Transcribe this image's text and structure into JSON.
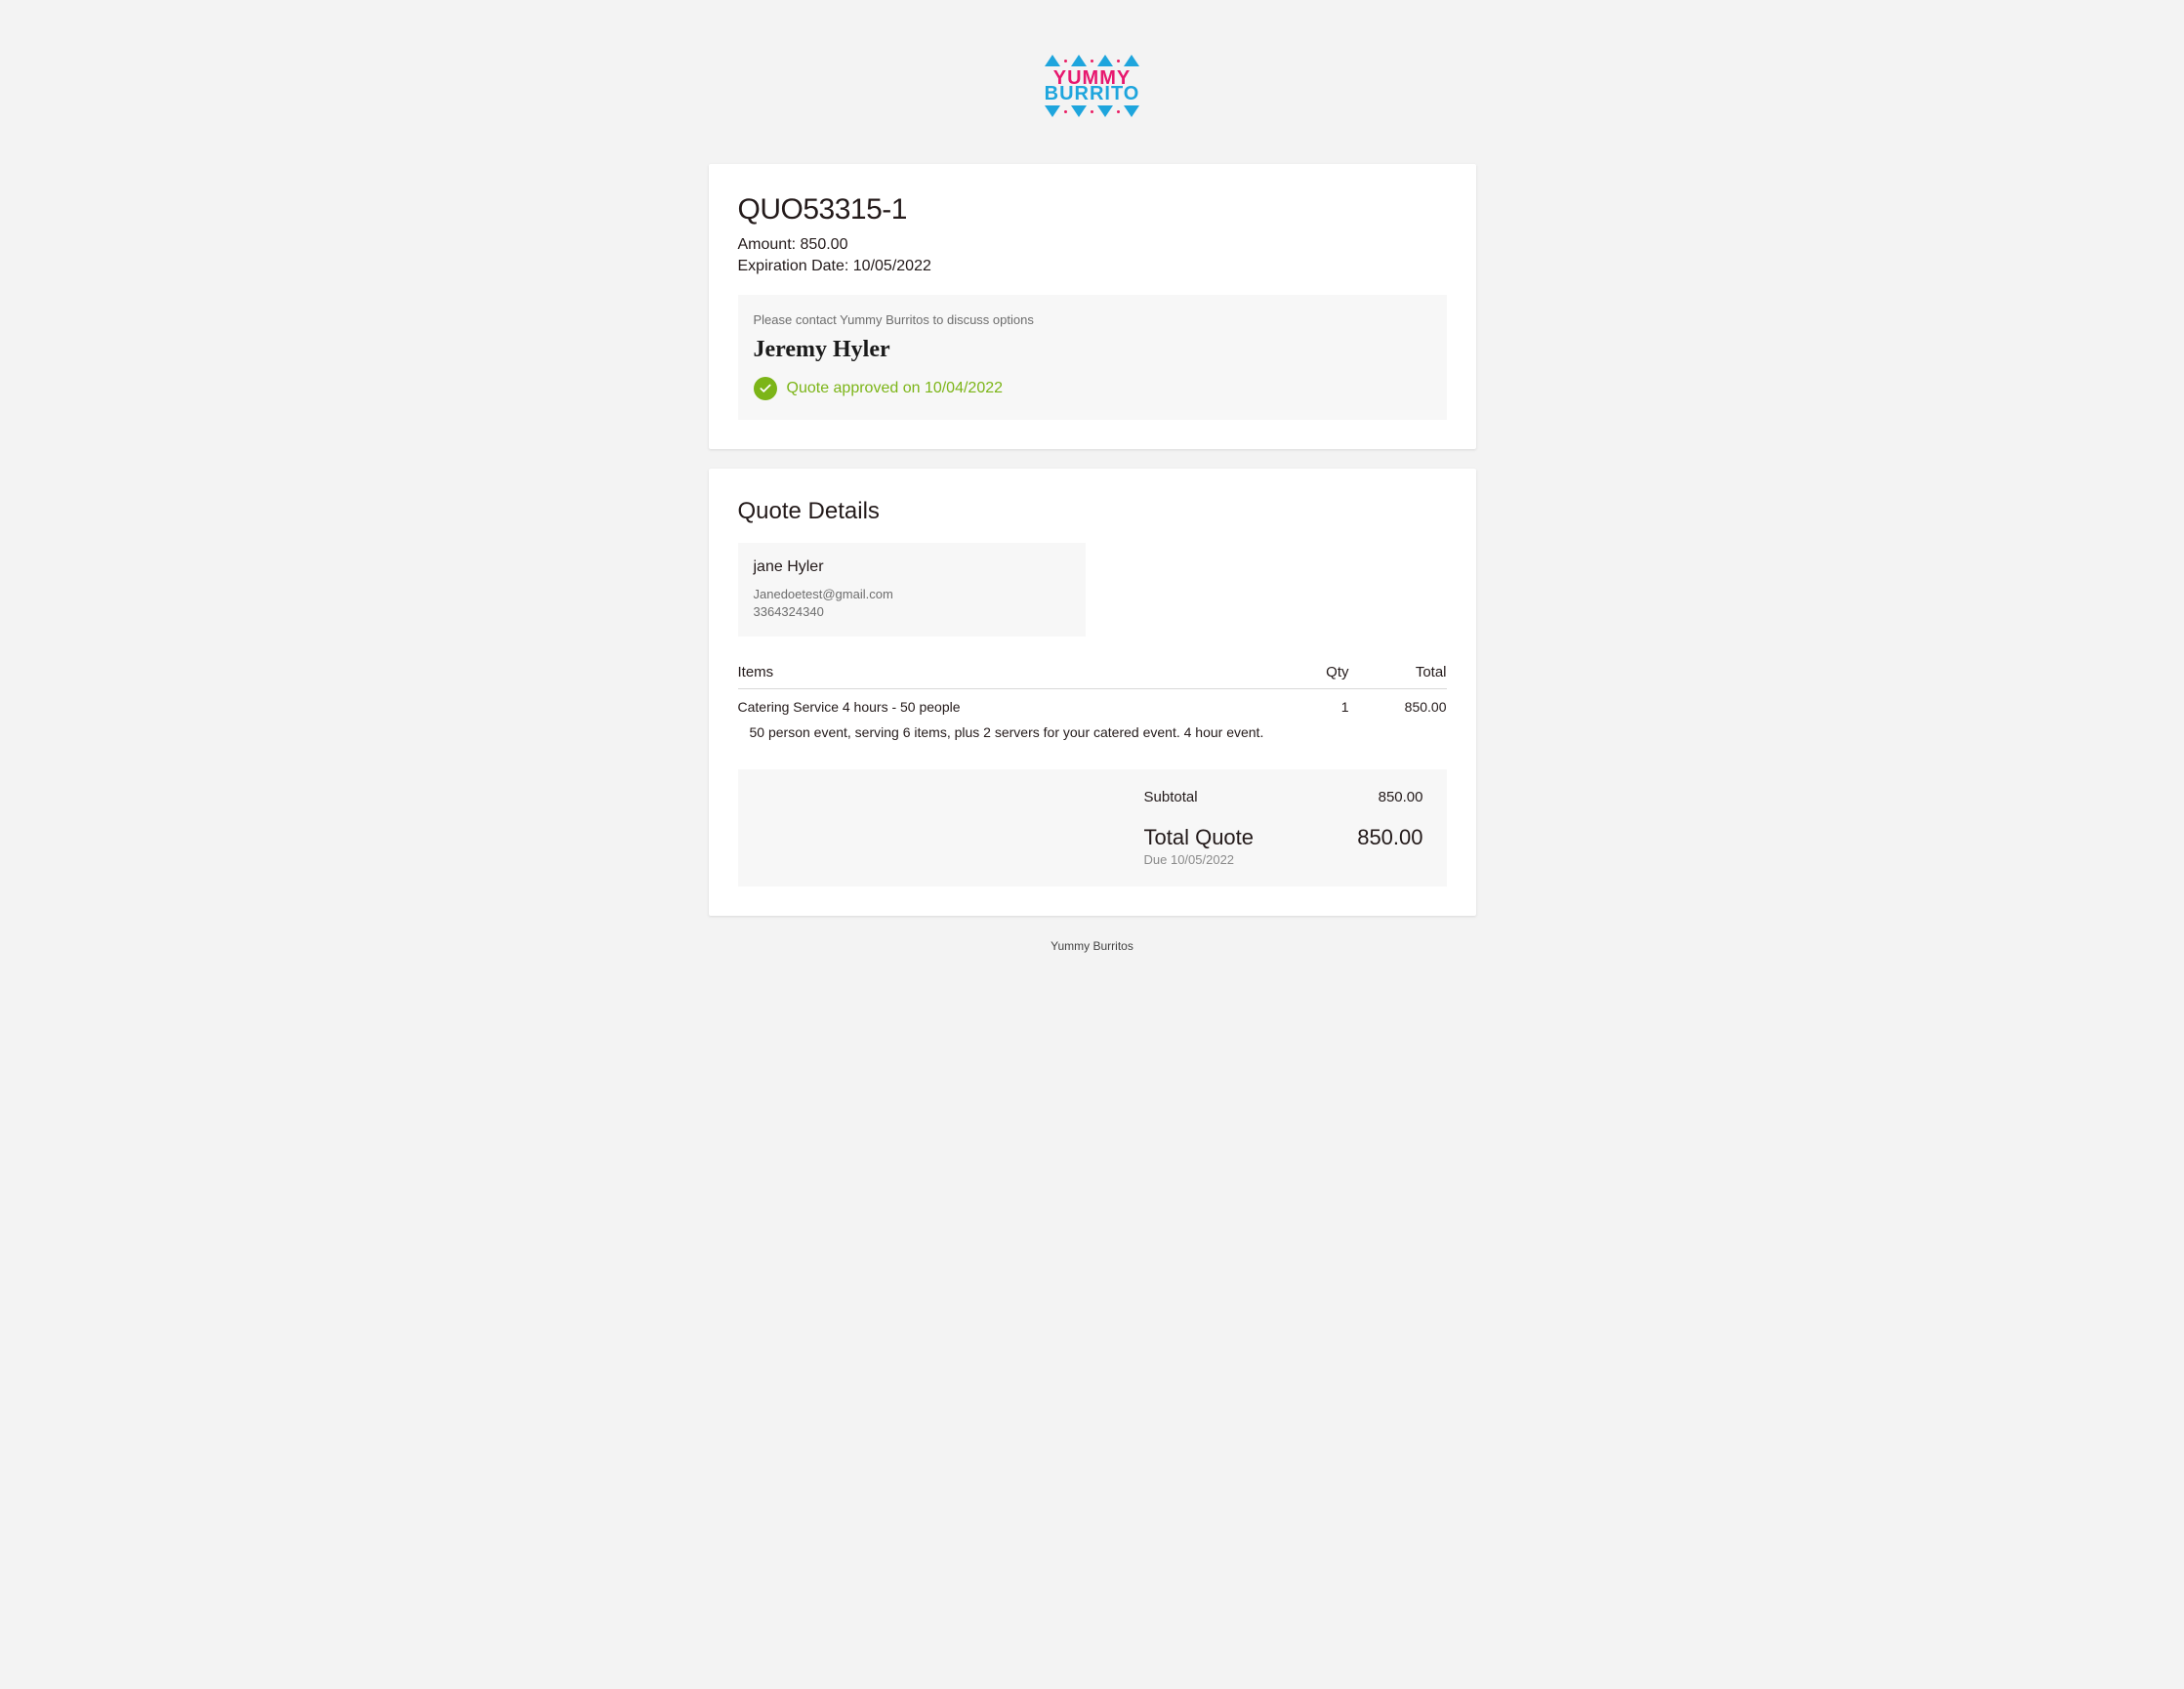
{
  "brand": {
    "line1": "YUMMY",
    "line2": "BURRITO"
  },
  "quote": {
    "number": "QUO53315-1",
    "amount_label": "Amount: ",
    "amount_value": "850.00",
    "expiration_label": "Expiration Date: ",
    "expiration_value": "10/05/2022"
  },
  "contact": {
    "note": "Please contact Yummy Burritos to discuss options",
    "signature": "Jeremy Hyler",
    "approved_text": "Quote approved on 10/04/2022"
  },
  "details": {
    "title": "Quote Details",
    "customer": {
      "name": "jane Hyler",
      "email": "Janedoetest@gmail.com",
      "phone": "3364324340"
    },
    "headers": {
      "items": "Items",
      "qty": "Qty",
      "total": "Total"
    },
    "line_item": {
      "name": "Catering Service 4 hours - 50 people",
      "description": "50 person event, serving 6 items, plus 2 servers for your catered event. 4 hour event.",
      "qty": "1",
      "total": "850.00"
    },
    "totals": {
      "subtotal_label": "Subtotal",
      "subtotal_value": "850.00",
      "total_label": "Total Quote",
      "total_value": "850.00",
      "due_label": "Due ",
      "due_date": "10/05/2022"
    }
  },
  "footer": "Yummy Burritos"
}
